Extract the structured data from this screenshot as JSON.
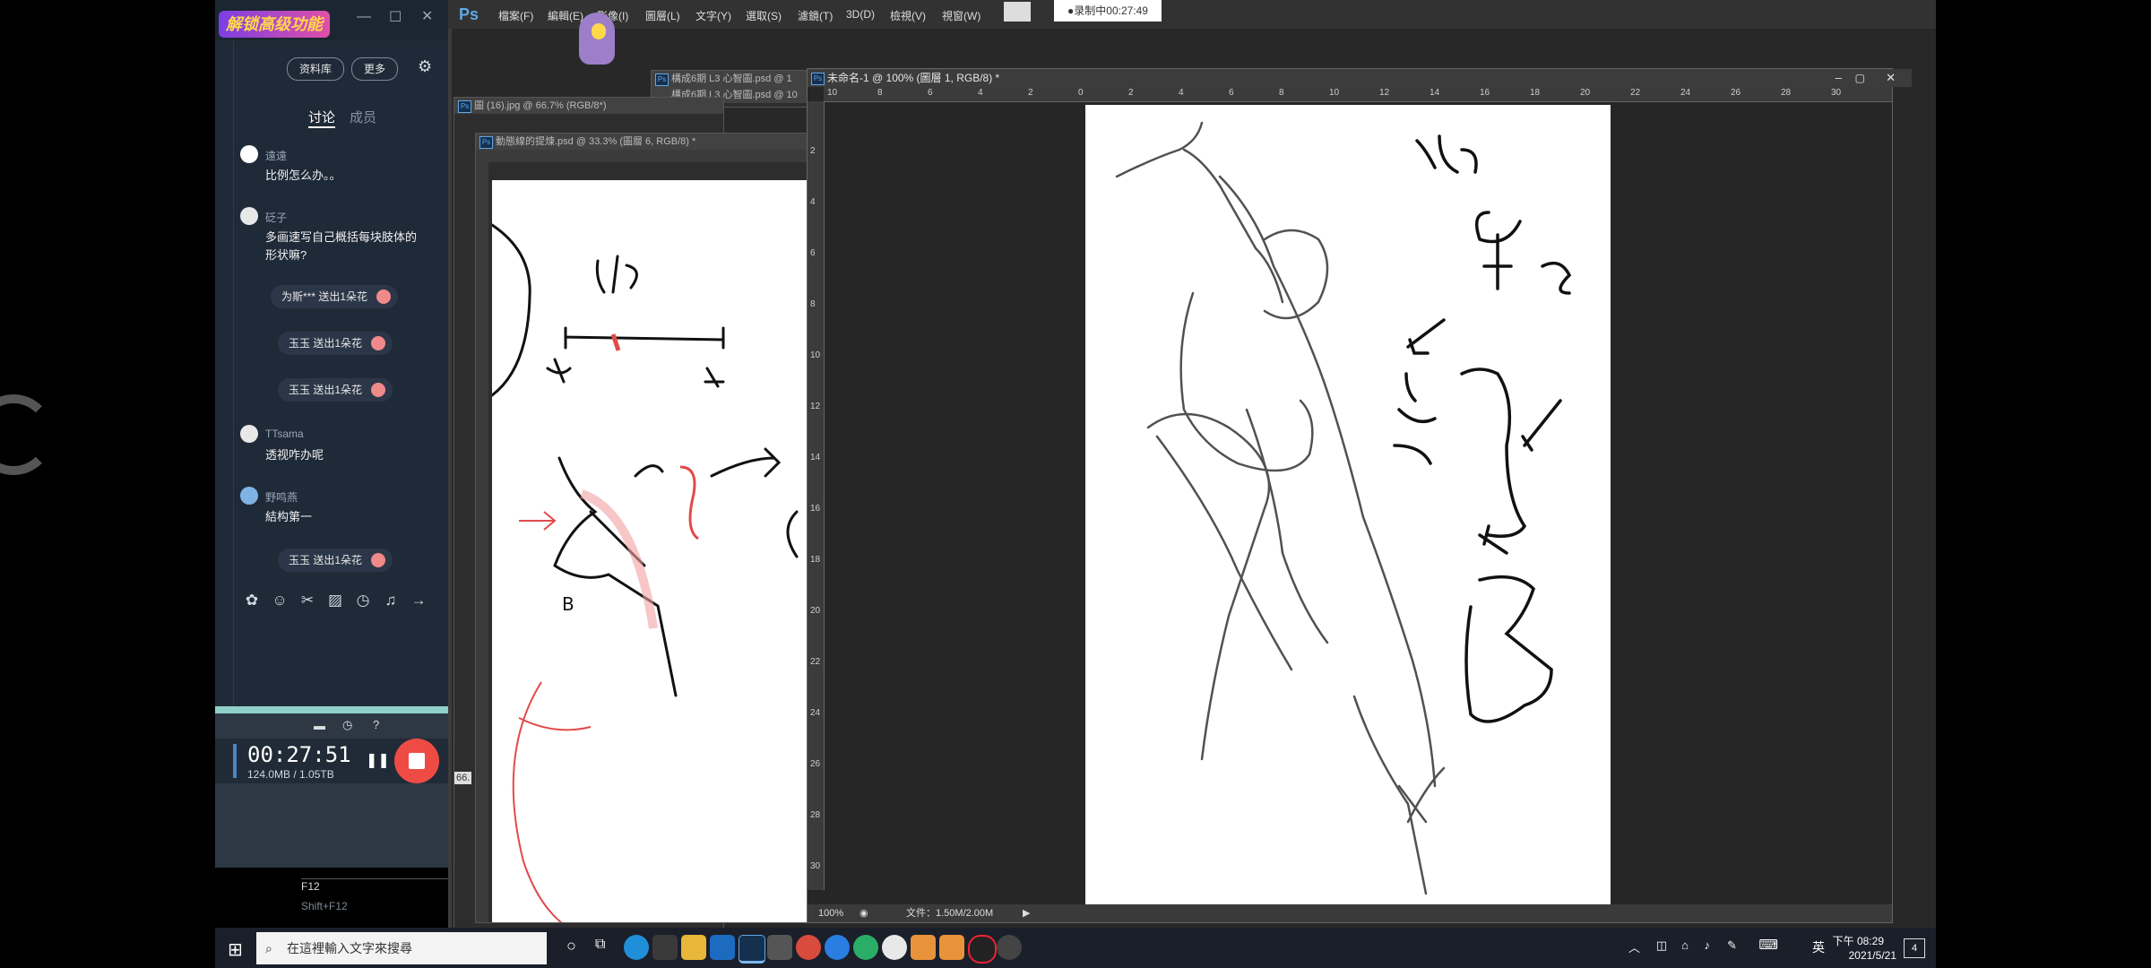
{
  "chat": {
    "promo": "解锁高级功能",
    "library_btn": "资料库",
    "more_btn": "更多",
    "tab_discuss": "讨论",
    "tab_members": "成员",
    "messages": [
      {
        "name": "遠遠",
        "text": "比例怎么办。。"
      },
      {
        "name": "砭子",
        "text": "多画速写自己概括每块肢体的形状嘛?"
      },
      {
        "name": "TTsama",
        "text": "透视咋办呢"
      },
      {
        "name": "野鸣燕",
        "text": "結构第一"
      }
    ],
    "gifts": [
      "为斯*** 送出1朵花",
      "玉玉 送出1朵花",
      "玉玉 送出1朵花",
      "玉玉 送出1朵花"
    ]
  },
  "recorder": {
    "time": "00:27:51",
    "size": "124.0MB / 1.05TB",
    "hotkey1": "F12",
    "hotkey2": "Shift+F12"
  },
  "photoshop": {
    "logo": "Ps",
    "menus": [
      "檔案(F)",
      "編輯(E)",
      "影像(I)",
      "圖層(L)",
      "文字(Y)",
      "選取(S)",
      "濾鏡(T)",
      "3D(D)",
      "檢視(V)",
      "視窗(W)"
    ],
    "recording_badge": "●录制中00:27:49",
    "doc_main_title": "未命名-1 @ 100% (圖層 1, RGB/8) *",
    "doc_left_title": "動態線的提煉.psd @ 33.3% (圖層 6, RGB/8) *",
    "doc_jpg_title": "圖 (16).jpg @ 66.7% (RGB/8*)",
    "doc_back1_title": "構成6期 L3 心智圖.psd @ 1",
    "doc_back2_title": "構成6期 L3 心智圖.psd @ 10",
    "zoom": "100%",
    "file_info": "文件：1.50M/2.00M",
    "left_zoom_hint": "66.",
    "ruler_top": [
      "10",
      "8",
      "6",
      "4",
      "2",
      "0",
      "2",
      "4",
      "6",
      "8",
      "10",
      "12",
      "14",
      "16",
      "18",
      "20",
      "22",
      "24",
      "26",
      "28",
      "30"
    ],
    "ruler_left": [
      "2",
      "4",
      "6",
      "8",
      "10",
      "12",
      "14",
      "16",
      "18",
      "20",
      "22",
      "24",
      "26",
      "28",
      "30"
    ]
  },
  "taskbar": {
    "search_placeholder": "在這裡輸入文字來搜尋",
    "lang": "英",
    "time": "下午 08:29",
    "date": "2021/5/21",
    "notifications": "4"
  },
  "colors": {
    "accent_red": "#ef4b45",
    "chat_bg": "#1f2a38",
    "ps_bg": "#282828"
  }
}
